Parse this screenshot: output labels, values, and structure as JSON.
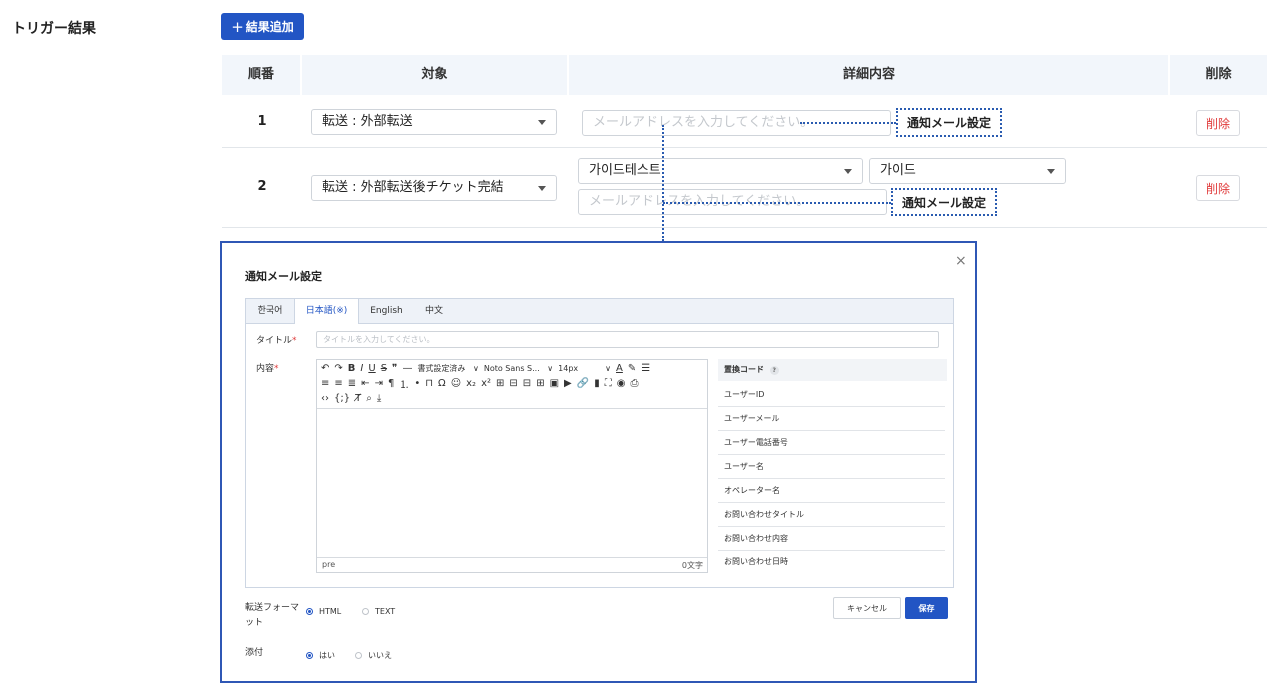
{
  "section": {
    "title": "トリガー結果",
    "add_button": "結果追加",
    "add_icon": "plus-icon"
  },
  "table": {
    "headers": {
      "order": "順番",
      "target": "対象",
      "detail": "詳細内容",
      "delete": "削除"
    },
    "rows": [
      {
        "order": "1",
        "target": "転送 : 外部転送",
        "email_placeholder": "メールアドレスを入力してください。",
        "notify_link": "通知メール設定",
        "delete": "削除"
      },
      {
        "order": "2",
        "target": "転送 : 外部転送後チケット完結",
        "select1": "가이드테스트",
        "select2": "가이드",
        "email_placeholder": "メールアドレスを入力してください。",
        "notify_link": "通知メール設定",
        "delete": "削除"
      }
    ]
  },
  "modal": {
    "title": "通知メール設定",
    "close": "×",
    "tabs": [
      "한국어",
      "日本語(※)",
      "English",
      "中文"
    ],
    "active_tab": "日本語(※)",
    "title_label": "タイトル",
    "title_placeholder": "タイトルを入力してください。",
    "content_label": "内容",
    "required_mark": "*",
    "toolbar": {
      "format_dropdown": "書式設定済み",
      "font_dropdown": "Noto Sans S...",
      "size_dropdown": "14px"
    },
    "editor_status": {
      "path": "pre",
      "count": "0文字"
    },
    "codes": {
      "header": "置換コード",
      "help": "?",
      "items": [
        "ユーザーID",
        "ユーザーメール",
        "ユーザー電話番号",
        "ユーザー名",
        "オペレーター名",
        "お問い合わせタイトル",
        "お問い合わせ内容",
        "お問い合わせ日時"
      ]
    },
    "format": {
      "label": "転送フォーマット",
      "options": [
        "HTML",
        "TEXT"
      ],
      "selected": "HTML"
    },
    "attach": {
      "label": "添付",
      "options": [
        "はい",
        "いいえ"
      ],
      "selected": "はい"
    },
    "buttons": {
      "cancel": "キャンセル",
      "save": "保存"
    }
  },
  "colors": {
    "primary": "#2255c4",
    "danger": "#e03a3a",
    "header_bg": "#f2f6fb",
    "callout": "#2a5bb0"
  }
}
